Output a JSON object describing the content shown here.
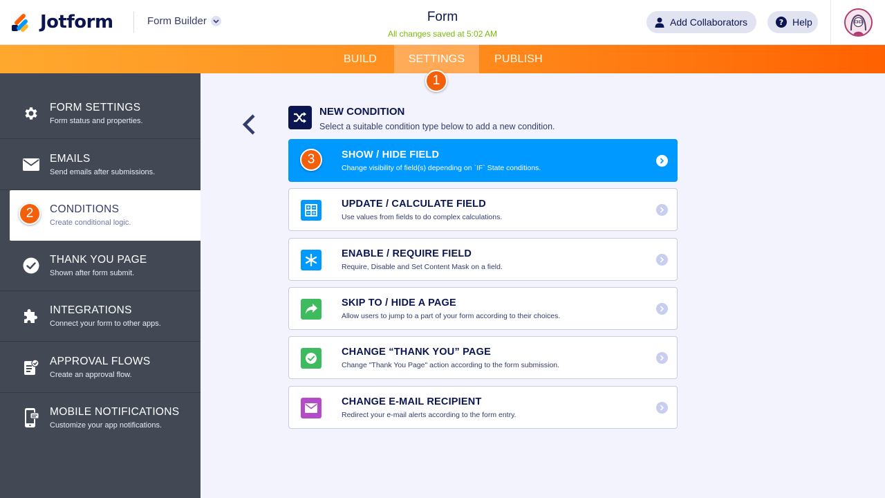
{
  "header": {
    "logo_text": "Jotform",
    "builder_label": "Form Builder",
    "form_title": "Form",
    "save_status": "All changes saved at 5:02 AM",
    "add_collaborators_label": "Add Collaborators",
    "help_label": "Help"
  },
  "nav": {
    "tabs": [
      {
        "label": "BUILD",
        "active": false
      },
      {
        "label": "SETTINGS",
        "active": true
      },
      {
        "label": "PUBLISH",
        "active": false
      }
    ]
  },
  "step_badges": [
    "1",
    "2",
    "3"
  ],
  "sidebar": {
    "items": [
      {
        "title": "FORM SETTINGS",
        "subtitle": "Form status and properties.",
        "icon": "gear-icon"
      },
      {
        "title": "EMAILS",
        "subtitle": "Send emails after submissions.",
        "icon": "envelope-icon"
      },
      {
        "title": "CONDITIONS",
        "subtitle": "Create conditional logic.",
        "icon": "conditions-icon",
        "active": true
      },
      {
        "title": "THANK YOU PAGE",
        "subtitle": "Shown after form submit.",
        "icon": "check-circle-icon"
      },
      {
        "title": "INTEGRATIONS",
        "subtitle": "Connect your form to other apps.",
        "icon": "puzzle-icon"
      },
      {
        "title": "APPROVAL FLOWS",
        "subtitle": "Create an approval flow.",
        "icon": "approval-icon"
      },
      {
        "title": "MOBILE NOTIFICATIONS",
        "subtitle": "Customize your app notifications.",
        "icon": "mobile-icon"
      }
    ]
  },
  "main": {
    "new_condition_title": "NEW CONDITION",
    "new_condition_subtitle": "Select a suitable condition type below to add a new condition.",
    "conditions": [
      {
        "title": "SHOW / HIDE FIELD",
        "subtitle": "Change visibility of field(s) depending on `IF` State conditions.",
        "selected": true,
        "icon": "shuffle-icon"
      },
      {
        "title": "UPDATE / CALCULATE FIELD",
        "subtitle": "Use values from fields to do complex calculations.",
        "icon": "calculator-icon",
        "color": "#0099ff"
      },
      {
        "title": "ENABLE / REQUIRE FIELD",
        "subtitle": "Require, Disable and Set Content Mask on a field.",
        "icon": "asterisk-icon",
        "color": "#0099ff"
      },
      {
        "title": "SKIP TO / HIDE A PAGE",
        "subtitle": "Allow users to jump to a part of your form according to their choices.",
        "icon": "share-arrow-icon",
        "color": "#3dbb5e"
      },
      {
        "title": "CHANGE “THANK YOU” PAGE",
        "subtitle": "Change \"Thank You Page\" action according to the form submission.",
        "icon": "check-circle-icon",
        "color": "#3dbb5e"
      },
      {
        "title": "CHANGE E-MAIL RECIPIENT",
        "subtitle": "Redirect your e-mail alerts according to the form entry.",
        "icon": "envelope-icon",
        "color": "#b44cc9"
      }
    ]
  },
  "colors": {
    "navy": "#0a1551",
    "orange_accent": "#f2600b",
    "selected_blue": "#0099ff",
    "sidebar_bg": "#424955"
  }
}
